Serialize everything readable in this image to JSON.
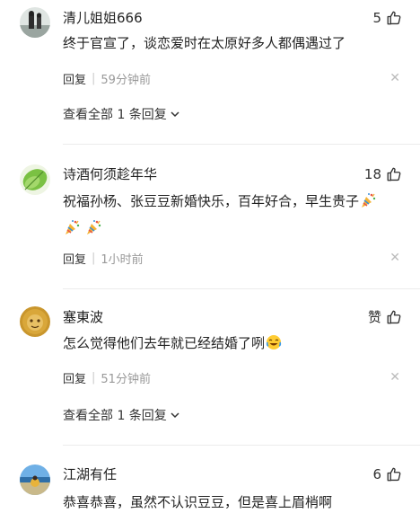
{
  "comments": [
    {
      "username": "清儿姐姐666",
      "likes": "5",
      "text": "终于官宣了，谈恋爱时在太原好多人都偶遇过了",
      "reply_label": "回复",
      "time": "59分钟前",
      "view_all": "查看全部 1 条回复"
    },
    {
      "username": "诗酒何须趁年华",
      "likes": "18",
      "text": "祝福孙杨、张豆豆新婚快乐，百年好合，早生贵子",
      "reply_label": "回复",
      "time": "1小时前"
    },
    {
      "username": "塞東波",
      "likes": "赞",
      "text": "怎么觉得他们去年就已经结婚了咧",
      "reply_label": "回复",
      "time": "51分钟前",
      "view_all": "查看全部 1 条回复"
    },
    {
      "username": "江湖有任",
      "likes": "6",
      "text": "恭喜恭喜，虽然不认识豆豆，但是喜上眉梢啊"
    }
  ],
  "colors": {
    "text": "#222222",
    "meta": "#999999",
    "divider": "#ececec"
  },
  "icons": [
    "thumbs-up-icon",
    "close-icon",
    "chevron-down-icon",
    "party-popper-icon",
    "laughing-crying-emoji-icon"
  ]
}
